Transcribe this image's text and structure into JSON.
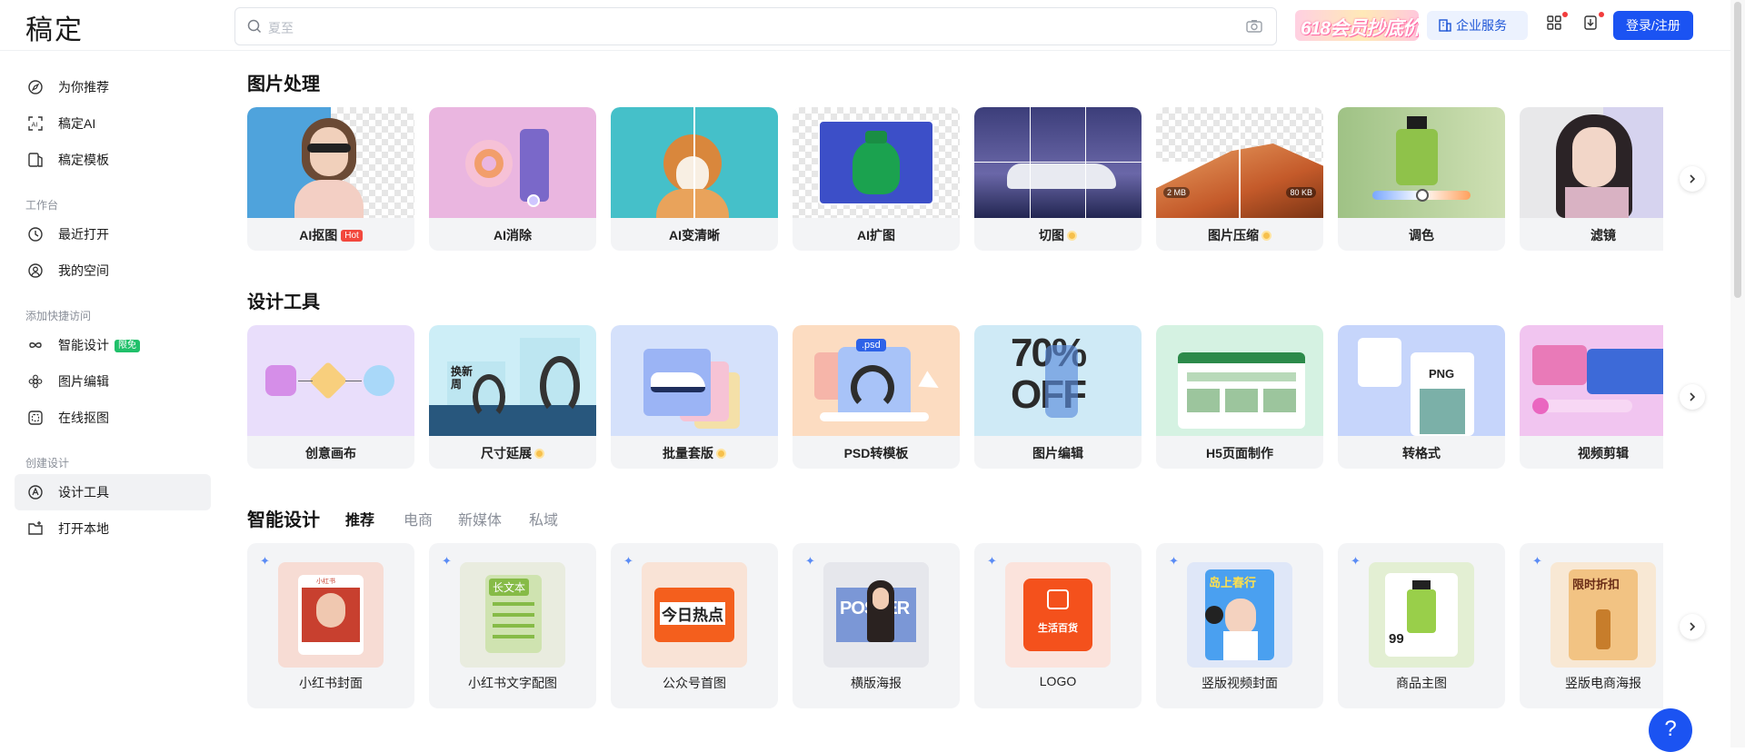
{
  "header": {
    "logo": "稿定",
    "search_placeholder": "夏至",
    "promo": "618会员抄底价",
    "enterprise": "企业服务",
    "login": "登录/注册"
  },
  "sidebar": {
    "top_items": [
      "为你推荐",
      "稿定AI",
      "稿定模板"
    ],
    "group_workspace": "工作台",
    "workspace_items": [
      "最近打开",
      "我的空间"
    ],
    "group_quick": "添加快捷访问",
    "quick_items": [
      "智能设计",
      "图片编辑",
      "在线抠图"
    ],
    "quick_badge": "限免",
    "group_create": "创建设计",
    "create_items": [
      "设计工具",
      "打开本地"
    ]
  },
  "image_processing": {
    "title": "图片处理",
    "hot_badge": "Hot",
    "items": [
      "AI抠图",
      "AI消除",
      "AI变清晰",
      "AI扩图",
      "切图",
      "图片压缩",
      "调色",
      "滤镜"
    ],
    "compress_before": "2 MB",
    "compress_after": "80 KB"
  },
  "design_tools": {
    "title": "设计工具",
    "items": [
      "创意画布",
      "尺寸延展",
      "批量套版",
      "PSD转模板",
      "图片编辑",
      "H5页面制作",
      "转格式",
      "视频剪辑"
    ],
    "thumb_text": {
      "swap": "换新周",
      "psd": ".psd",
      "off": "70% OFF",
      "png": "PNG"
    }
  },
  "smart_design": {
    "title": "智能设计",
    "tabs": [
      "推荐",
      "电商",
      "新媒体",
      "私域"
    ],
    "active_tab": "推荐",
    "items": [
      "小红书封面",
      "小红书文字配图",
      "公众号首图",
      "横版海报",
      "LOGO",
      "竖版视频封面",
      "商品主图",
      "竖版电商海报"
    ],
    "thumb_text": {
      "longtext": "长文本",
      "hot": "今日热点",
      "poster": "POSTER",
      "shop": "生活百货",
      "spring": "岛上春行",
      "price": "99",
      "sale": "限时折扣",
      "xhs": "小红书"
    }
  },
  "help": "?"
}
